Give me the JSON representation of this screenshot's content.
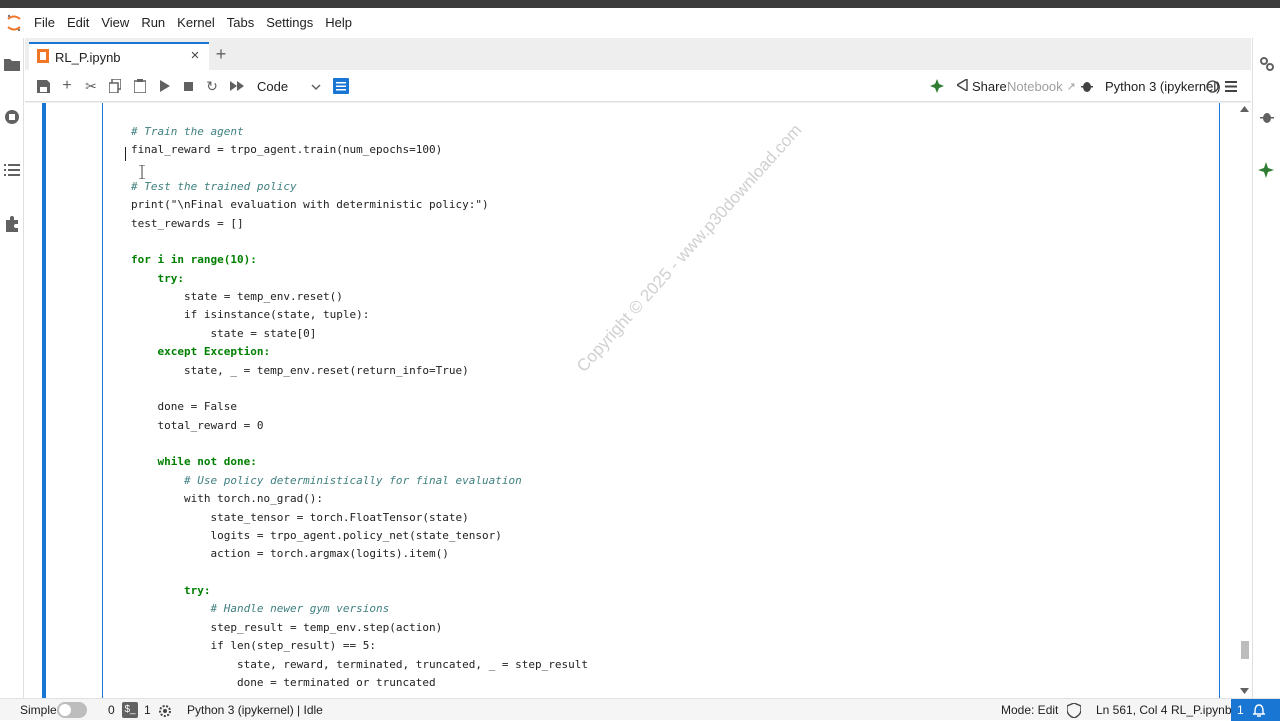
{
  "menu": [
    "File",
    "Edit",
    "View",
    "Run",
    "Kernel",
    "Tabs",
    "Settings",
    "Help"
  ],
  "tab": {
    "label": "RL_P.ipynb"
  },
  "toolbar": {
    "cell_type": "Code",
    "share": "Share",
    "notebook": "Notebook",
    "kernel": "Python 3 (ipykernel)"
  },
  "code_lines": [
    "# Train the agent",
    "final_reward = trpo_agent.train(num_epochs=100)",
    "",
    "# Test the trained policy",
    "print(\"\\nFinal evaluation with deterministic policy:\")",
    "test_rewards = []",
    "",
    "for i in range(10):",
    "    try:",
    "        state = temp_env.reset()",
    "        if isinstance(state, tuple):",
    "            state = state[0]",
    "    except Exception:",
    "        state, _ = temp_env.reset(return_info=True)",
    "",
    "    done = False",
    "    total_reward = 0",
    "",
    "    while not done:",
    "        # Use policy deterministically for final evaluation",
    "        with torch.no_grad():",
    "            state_tensor = torch.FloatTensor(state)",
    "            logits = trpo_agent.policy_net(state_tensor)",
    "            action = torch.argmax(logits).item()",
    "",
    "        try:",
    "            # Handle newer gym versions",
    "            step_result = temp_env.step(action)",
    "            if len(step_result) == 5:",
    "                state, reward, terminated, truncated, _ = step_result",
    "                done = terminated or truncated"
  ],
  "watermark": "Copyright © 2025 - www.p30download.com",
  "status": {
    "mode_label": "Simple",
    "count_a": "0",
    "count_b": "1",
    "kernel_status": "Python 3 (ipykernel) | Idle",
    "mode": "Mode: Edit",
    "position": "Ln 561, Col 4",
    "file": "RL_P.ipynb",
    "notifications": "1"
  },
  "colors": {
    "accent": "#1976d2",
    "comment": "#408080",
    "keyword": "#008000",
    "string": "#ba2121"
  }
}
